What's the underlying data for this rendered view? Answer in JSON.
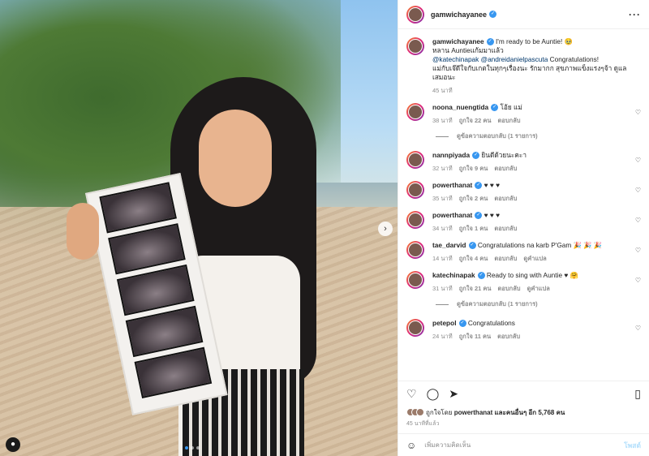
{
  "photo": {
    "next_icon": "chevron-right-icon",
    "tag_icon": "person-icon",
    "dot_count": 3
  },
  "header": {
    "username": "gamwichayanee",
    "verified_icon": "verified-check-icon",
    "more_icon": "ellipsis-icon"
  },
  "caption": {
    "username": "gamwichayanee",
    "line1": "I'm ready to be Auntie! 🥹",
    "line2": "หลาน Auntieแก้มมาแล้ว",
    "mention1": "@katechinapak",
    "mention2": "@andreidanielpascuta",
    "line3": "Congratulations!",
    "line4": "แม่กับเจ๊ดีใจกับเกตในทุกๆเรื่องนะ รักมากก สุขภาพแข็งแรงๆจ้า ดูแลเสมอนะ",
    "time": "45 นาที"
  },
  "comments": [
    {
      "username": "noona_nuengtida",
      "text": "โอ้ย แม่",
      "time": "38 นาที",
      "likes": "ถูกใจ 22 คน",
      "reply": "ตอบกลับ",
      "translate": "",
      "view_replies": "ดูข้อความตอบกลับ (1 รายการ)"
    },
    {
      "username": "nannpiyada",
      "text": "ยินดีด้วยนะคะา",
      "time": "32 นาที",
      "likes": "ถูกใจ 9 คน",
      "reply": "ตอบกลับ",
      "translate": "",
      "view_replies": ""
    },
    {
      "username": "powerthanat",
      "text": "♥ ♥ ♥",
      "time": "35 นาที",
      "likes": "ถูกใจ 2 คน",
      "reply": "ตอบกลับ",
      "translate": "",
      "view_replies": ""
    },
    {
      "username": "powerthanat",
      "text": "♥ ♥ ♥",
      "time": "34 นาที",
      "likes": "ถูกใจ 1 คน",
      "reply": "ตอบกลับ",
      "translate": "",
      "view_replies": ""
    },
    {
      "username": "tae_darvid",
      "text": "Congratulations na karb P'Gam 🎉 🎉 🎉",
      "time": "14 นาที",
      "likes": "ถูกใจ 4 คน",
      "reply": "ตอบกลับ",
      "translate": "ดูคำแปล",
      "view_replies": ""
    },
    {
      "username": "katechinapak",
      "text": "Ready to sing with Auntie ♥ 🤗",
      "time": "31 นาที",
      "likes": "ถูกใจ 21 คน",
      "reply": "ตอบกลับ",
      "translate": "ดูคำแปล",
      "view_replies": "ดูข้อความตอบกลับ (1 รายการ)"
    },
    {
      "username": "petepol",
      "text": "Congratulations",
      "time": "24 นาที",
      "likes": "ถูกใจ 11 คน",
      "reply": "ตอบกลับ",
      "translate": "",
      "view_replies": ""
    }
  ],
  "actions": {
    "like_icon": "heart-icon",
    "comment_icon": "comment-icon",
    "share_icon": "send-icon",
    "save_icon": "bookmark-icon"
  },
  "likes": {
    "prefix": "ถูกใจโดย",
    "user": "powerthanat",
    "suffix": "และคนอื่นๆ อีก 5,768 คน"
  },
  "post_time": "45 นาทีที่แล้ว",
  "comment_box": {
    "emoji_icon": "smiley-icon",
    "placeholder": "เพิ่มความคิดเห็น",
    "post_label": "โพสต์"
  },
  "colors": {
    "link_blue": "#00376b",
    "verified_blue": "#3897f0",
    "post_button": "#b2dffc"
  }
}
